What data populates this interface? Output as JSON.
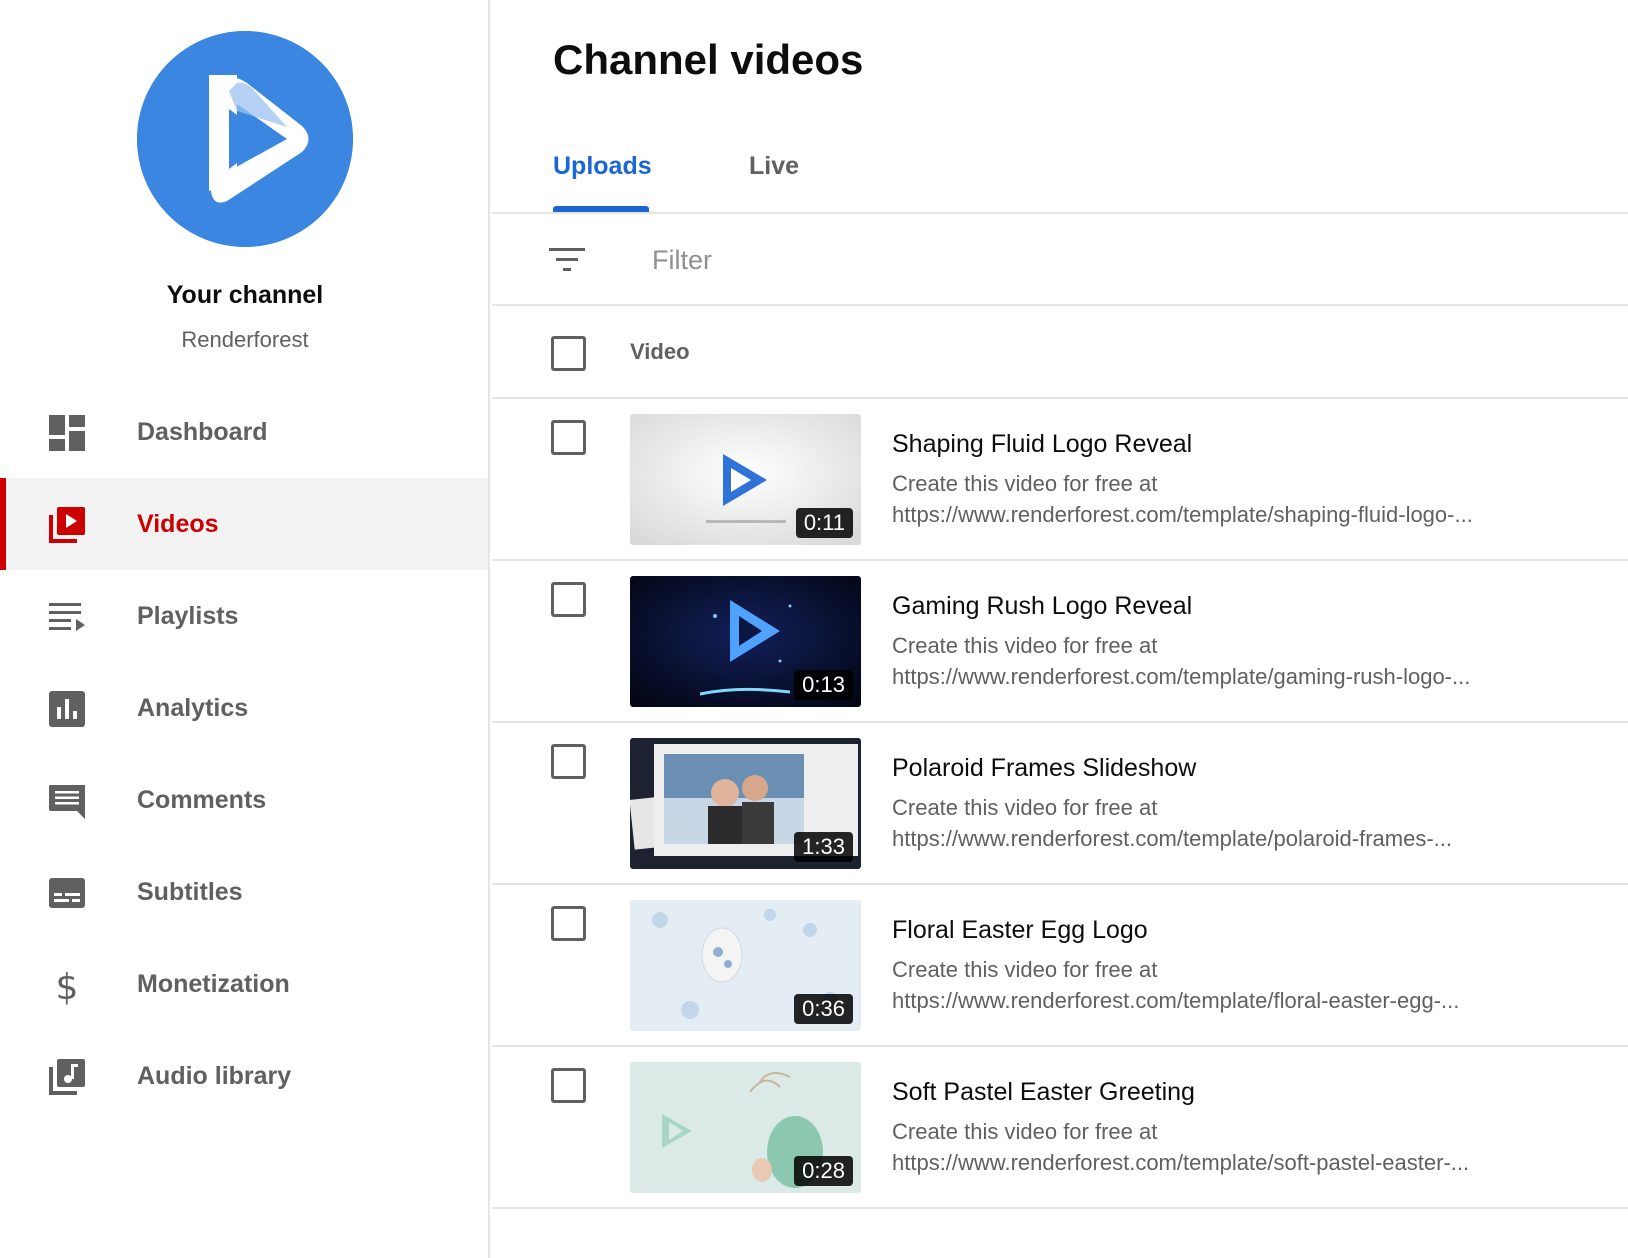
{
  "sidebar": {
    "channel_title": "Your channel",
    "channel_name": "Renderforest",
    "items": [
      {
        "label": "Dashboard",
        "icon": "dashboard-icon",
        "active": false
      },
      {
        "label": "Videos",
        "icon": "videos-icon",
        "active": true
      },
      {
        "label": "Playlists",
        "icon": "playlists-icon",
        "active": false
      },
      {
        "label": "Analytics",
        "icon": "analytics-icon",
        "active": false
      },
      {
        "label": "Comments",
        "icon": "comments-icon",
        "active": false
      },
      {
        "label": "Subtitles",
        "icon": "subtitles-icon",
        "active": false
      },
      {
        "label": "Monetization",
        "icon": "monetization-icon",
        "active": false
      },
      {
        "label": "Audio library",
        "icon": "audio-library-icon",
        "active": false
      }
    ]
  },
  "main": {
    "title": "Channel videos",
    "tabs": [
      {
        "label": "Uploads",
        "active": true
      },
      {
        "label": "Live",
        "active": false
      }
    ],
    "filter": {
      "placeholder": "Filter",
      "value": ""
    },
    "table_header": {
      "video_label": "Video"
    },
    "videos": [
      {
        "title": "Shaping Fluid Logo Reveal",
        "desc_line1": "Create this video for free at",
        "desc_line2": "https://www.renderforest.com/template/shaping-fluid-logo-...",
        "duration": "0:11"
      },
      {
        "title": "Gaming Rush Logo Reveal",
        "desc_line1": "Create this video for free at",
        "desc_line2": "https://www.renderforest.com/template/gaming-rush-logo-...",
        "duration": "0:13"
      },
      {
        "title": "Polaroid Frames Slideshow",
        "desc_line1": "Create this video for free at",
        "desc_line2": "https://www.renderforest.com/template/polaroid-frames-...",
        "duration": "1:33"
      },
      {
        "title": "Floral Easter Egg Logo",
        "desc_line1": "Create this video for free at",
        "desc_line2": "https://www.renderforest.com/template/floral-easter-egg-...",
        "duration": "0:36"
      },
      {
        "title": "Soft Pastel Easter Greeting",
        "desc_line1": "Create this video for free at",
        "desc_line2": "https://www.renderforest.com/template/soft-pastel-easter-...",
        "duration": "0:28"
      }
    ]
  },
  "colors": {
    "accent_blue": "#1a66d2",
    "active_red": "#cc0000",
    "avatar_blue": "#3a86e0",
    "muted_text": "#606060"
  }
}
